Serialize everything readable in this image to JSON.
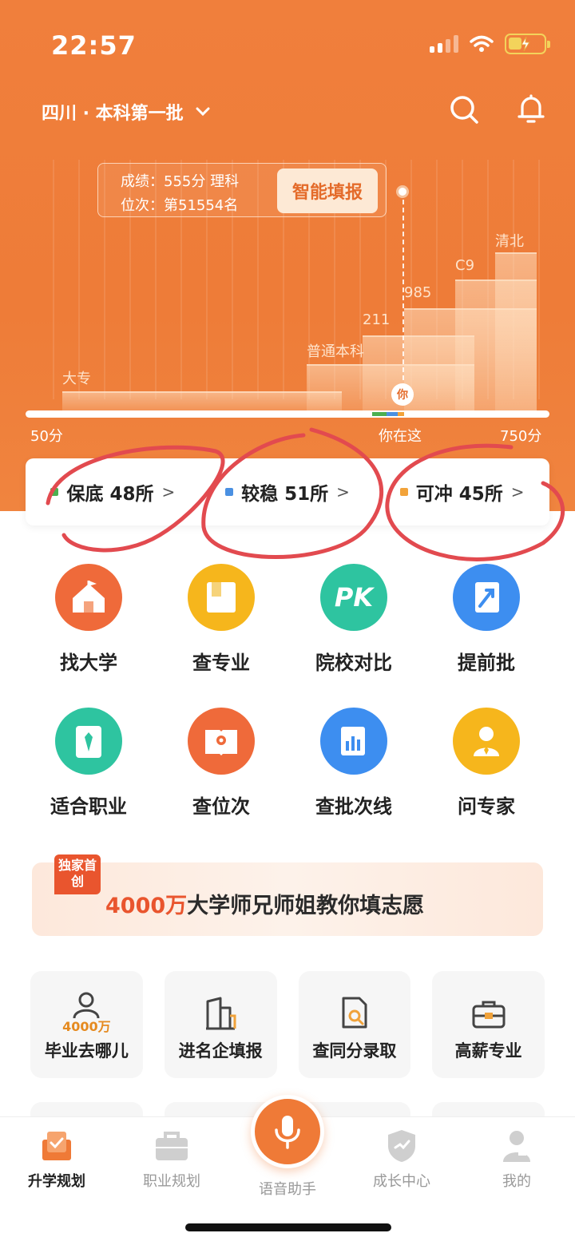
{
  "status": {
    "time": "22:57"
  },
  "header": {
    "region": "四川 · 本科第一批"
  },
  "chart_data": {
    "type": "area",
    "tiers": [
      "大专",
      "普通本科",
      "211",
      "985",
      "C9",
      "清北"
    ],
    "axis_min_label": "50分",
    "axis_max_label": "750分",
    "you_label": "你在这",
    "you_pin": "你"
  },
  "score_box": {
    "score_line": "成绩：555分 理科",
    "rank_line": "位次：第51554名",
    "cta": "智能填报"
  },
  "tabs": [
    {
      "label": "保底 48所",
      "color": "#4caf50"
    },
    {
      "label": "较稳 51所",
      "color": "#4a90e2"
    },
    {
      "label": "可冲 45所",
      "color": "#f2a33a"
    }
  ],
  "grid": [
    {
      "label": "找大学",
      "icon": "school-icon",
      "color": "#ef6a3a"
    },
    {
      "label": "查专业",
      "icon": "book-icon",
      "color": "#f6b61c"
    },
    {
      "label": "院校对比",
      "icon": "pk-icon",
      "color": "#2ec4a0"
    },
    {
      "label": "提前批",
      "icon": "flag-arrow-icon",
      "color": "#3d8ef0"
    },
    {
      "label": "适合职业",
      "icon": "tie-icon",
      "color": "#2ec4a0"
    },
    {
      "label": "查位次",
      "icon": "rank-book-icon",
      "color": "#ef6a3a"
    },
    {
      "label": "查批次线",
      "icon": "bar-chart-icon",
      "color": "#3d8ef0"
    },
    {
      "label": "问专家",
      "icon": "expert-icon",
      "color": "#f6b61c"
    }
  ],
  "banner": {
    "badge": "独家首创",
    "highlight": "4000万",
    "text": "大学师兄师姐教你填志愿"
  },
  "cards": [
    {
      "label": "毕业去哪儿",
      "sub": "4000万",
      "icon": "person-icon"
    },
    {
      "label": "进名企填报",
      "icon": "building-icon"
    },
    {
      "label": "查同分录取",
      "icon": "doc-search-icon"
    },
    {
      "label": "高薪专业",
      "icon": "briefcase-icon"
    }
  ],
  "nav": [
    {
      "label": "升学规划",
      "icon": "plan-icon",
      "active": true
    },
    {
      "label": "职业规划",
      "icon": "briefcase-icon"
    },
    {
      "label": "语音助手",
      "icon": "mic-icon"
    },
    {
      "label": "成长中心",
      "icon": "shield-icon"
    },
    {
      "label": "我的",
      "icon": "user-icon"
    }
  ]
}
